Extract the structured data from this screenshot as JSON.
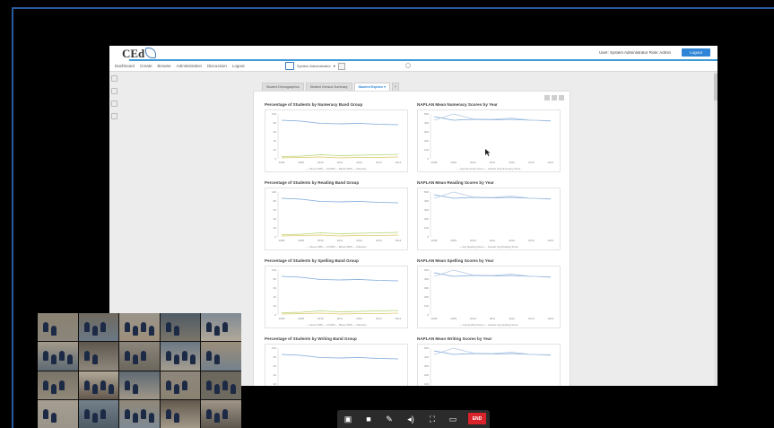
{
  "app": {
    "logo": "CEd",
    "nav": [
      "Dashboard",
      "Create",
      "Browse",
      "Administration",
      "Discussion",
      "Logout"
    ],
    "user_info": "User: System Administrator  Role: Admin",
    "logout_label": "Logout",
    "selector_label": "System Administrator"
  },
  "tabs": [
    "Student Demographics",
    "Student Census Summary",
    "Student Explore ▾",
    "+"
  ],
  "charts": [
    {
      "title": "Percentage of Students by Numeracy Band Group",
      "legend": "— Above NMS  — At NMS  — Below NMS  — Unknown"
    },
    {
      "title": "NAPLAN Mean Numeracy Scores by Year",
      "legend": "— Avg Numeracy Score  — Greater Avg Numeracy Score"
    },
    {
      "title": "Percentage of Students by Reading Band Group",
      "legend": "— Above NMS  — At NMS  — Below NMS  — Unknown"
    },
    {
      "title": "NAPLAN Mean Reading Scores by Year",
      "legend": "— Avg Reading Score  — Greater Avg Reading Score"
    },
    {
      "title": "Percentage of Students by Spelling Band Group",
      "legend": "— Above NMS  — At NMS  — Below NMS  — Unknown"
    },
    {
      "title": "NAPLAN Mean Spelling Scores by Year",
      "legend": "— Avg Spelling Score  — Greater Avg Spelling Score"
    },
    {
      "title": "Percentage of Students by Writing Band Group",
      "legend": ""
    },
    {
      "title": "NAPLAN Mean Writing Scores by Year",
      "legend": ""
    }
  ],
  "years": [
    "2008",
    "2009",
    "2010",
    "2011",
    "2012",
    "2013",
    "2014"
  ],
  "pct_ticks": [
    "100",
    "80",
    "60",
    "40",
    "20",
    "0"
  ],
  "score_ticks": [
    "500",
    "400",
    "300",
    "200",
    "100",
    "0"
  ],
  "colors": {
    "accent": "#2f86d6",
    "end": "#d8232a",
    "line_primary": "#7aa7d8",
    "line_secondary": "#b8cbe4",
    "line_tertiary": "#b4d36e",
    "line_quaternary": "#e0c66a"
  },
  "toolbar": {
    "end_label": "END",
    "icons": [
      "screen-share-icon",
      "camera-icon",
      "mute-mic-icon",
      "speaker-icon",
      "fullscreen-icon",
      "layout-icon"
    ]
  },
  "series": {
    "pct_above": [
      86,
      84,
      79,
      78,
      79,
      77,
      76
    ],
    "pct_at": [
      5,
      6,
      9,
      7,
      8,
      9,
      10
    ],
    "pct_below": [
      2,
      3,
      4,
      2,
      3,
      3,
      4
    ],
    "score_avg": [
      470,
      430,
      440,
      435,
      440,
      430,
      425
    ],
    "score_state": [
      430,
      500,
      445,
      440,
      455,
      430,
      420
    ]
  }
}
